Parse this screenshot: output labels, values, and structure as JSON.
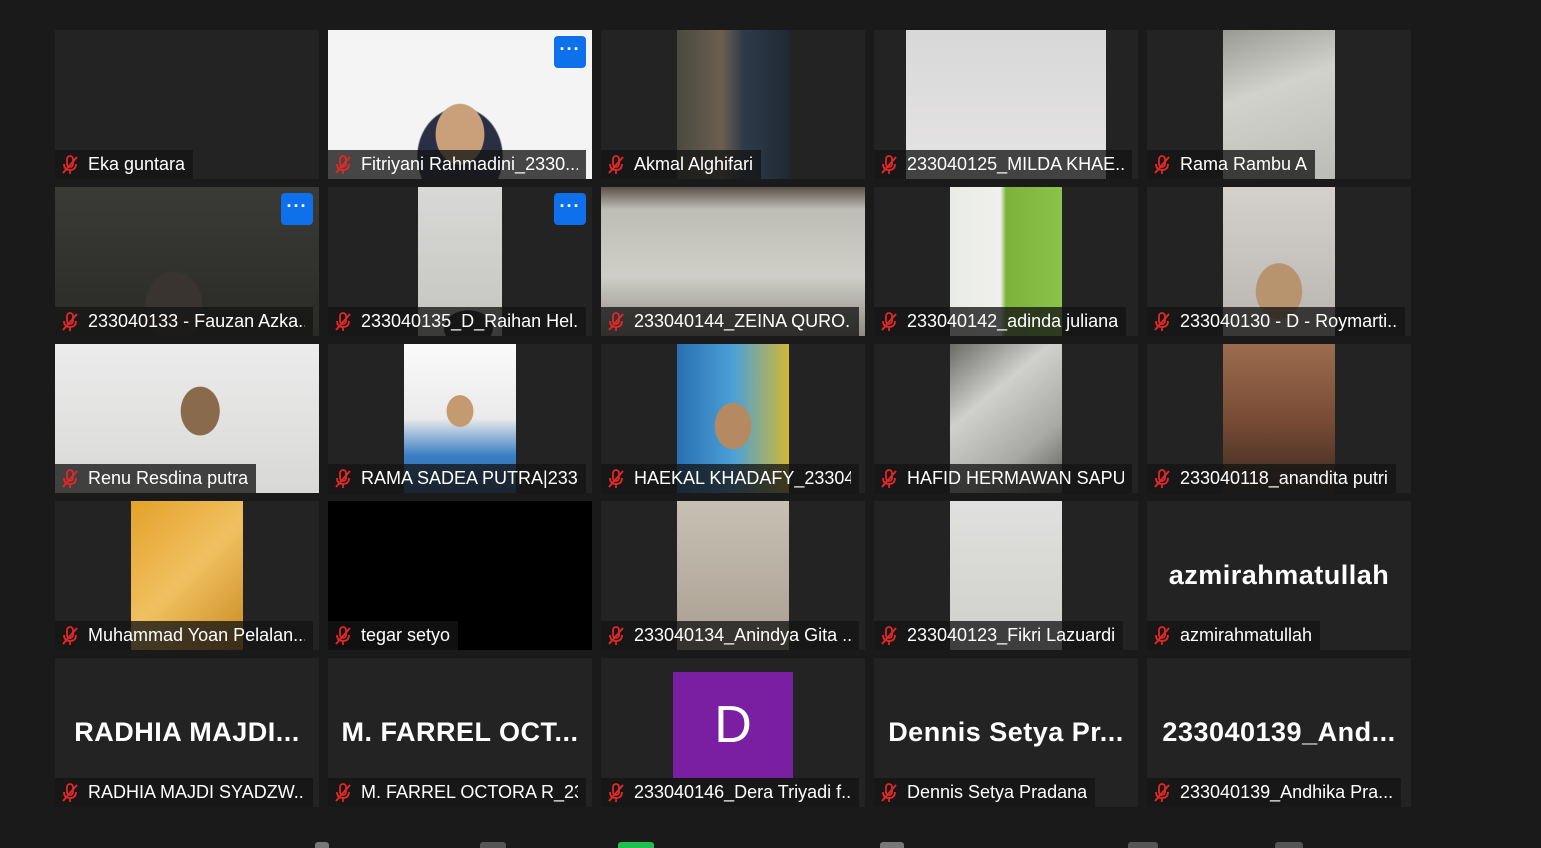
{
  "participants": [
    {
      "name": "Eka guntara",
      "video": "none"
    },
    {
      "name": "Fitriyani Rahmadini_2330...",
      "video": "girl-hijab",
      "more_button": "···"
    },
    {
      "name": "Akmal Alghifari",
      "video": "two-boys"
    },
    {
      "name": "233040125_MILDA KHAE...",
      "video": "wall-gray"
    },
    {
      "name": "Rama Rambu A",
      "video": "ceiling"
    },
    {
      "name": "233040133 - Fauzan Azka...",
      "video": "dark-boy-full",
      "more_button": "···"
    },
    {
      "name": "233040135_D_Raihan Hel...",
      "video": "boy-ceiling",
      "more_button": "···"
    },
    {
      "name": "233040144_ZEINA QURO...",
      "video": "room-full"
    },
    {
      "name": "233040142_adinda juliana",
      "video": "green-room"
    },
    {
      "name": "233040130 - D - Roymarti...",
      "video": "boy-glasses"
    },
    {
      "name": "Renu Resdina putra",
      "video": "boy-white-full"
    },
    {
      "name": "RAMA SADEA PUTRA|233...",
      "video": "boy-blue"
    },
    {
      "name": "HAEKAL KHADAFY_23304...",
      "video": "boy-mural"
    },
    {
      "name": "HAFID HERMAWAN SAPU...",
      "video": "ceiling-light"
    },
    {
      "name": "233040118_anandita putri",
      "video": "wood"
    },
    {
      "name": "Muhammad Yoan Pelalan...",
      "video": "orange"
    },
    {
      "name": "tegar setyo",
      "video": "black-full"
    },
    {
      "name": "233040134_Anindya Gita ...",
      "video": "beige-wall"
    },
    {
      "name": "233040123_Fikri Lazuardi",
      "video": "white-wall"
    },
    {
      "name": "azmirahmatullah",
      "video": "none",
      "display_name": "azmirahmatullah"
    },
    {
      "name": "RADHIA MAJDI SYADZW...",
      "video": "none",
      "display_name": "RADHIA  MAJDI..."
    },
    {
      "name": "M. FARREL OCTORA R_23...",
      "video": "none",
      "display_name": "M.  FARREL  OCT..."
    },
    {
      "name": "233040146_Dera Triyadi f...",
      "video": "none",
      "avatar_letter": "D"
    },
    {
      "name": "Dennis Setya Pradana",
      "video": "none",
      "display_name": "Dennis  Setya  Pr..."
    },
    {
      "name": "233040139_Andhika Pra...",
      "video": "none",
      "display_name": "233040139_And..."
    }
  ],
  "colors": {
    "background": "#1a1a1a",
    "tile": "#232323",
    "accent_blue": "#0e71eb",
    "muted_red": "#e02828",
    "avatar_purple": "#7a1fa2"
  }
}
